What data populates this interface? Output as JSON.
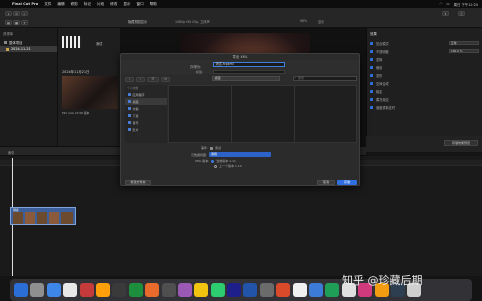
{
  "menubar": {
    "app": "Final Cut Pro",
    "items": [
      "文件",
      "编辑",
      "修剪",
      "标记",
      "片段",
      "修改",
      "显示",
      "窗口",
      "帮助"
    ],
    "status_text": "周日 下午12:20"
  },
  "toolbar": {
    "center_label": "隐藏视图显示",
    "resolution": "1080p HD 25p, 立体声",
    "zoom": "96%",
    "view": "显示"
  },
  "sidebar": {
    "title": "资源库",
    "items": [
      "整体项目",
      "2024-11-21"
    ]
  },
  "browser": {
    "clip_label": "测试",
    "date_header": "2024年11月21日",
    "clip_name": "film look 23.98 版本"
  },
  "inspector": {
    "title": "效果",
    "rows": [
      {
        "label": "复合模式",
        "value": "正常"
      },
      {
        "label": "不透明度",
        "value": "100.0 %"
      },
      {
        "label": "变换",
        "value": ""
      },
      {
        "label": "裁剪",
        "value": ""
      },
      {
        "label": "变形",
        "value": ""
      },
      {
        "label": "空间合成",
        "value": ""
      },
      {
        "label": "稳定",
        "value": ""
      },
      {
        "label": "果冻效应",
        "value": ""
      },
      {
        "label": "速度重新定时",
        "value": ""
      }
    ],
    "save_preset": "存储效果预置"
  },
  "timeline": {
    "index_label": "索引",
    "clip_label": "测试"
  },
  "dialog": {
    "title": "导出 XML",
    "save_as_label": "存储为:",
    "save_as_value": "测试.fcpxml",
    "tags_label": "标签:",
    "location": "桌面",
    "search_placeholder": "搜索",
    "sidebar_header": "个人收藏",
    "sidebar_items": [
      "应用程序",
      "桌面",
      "文稿",
      "下载",
      "音乐",
      "影片"
    ],
    "selected_item": "桌面",
    "project_label": "事件:",
    "project_value": "测试",
    "format_label": "元数据视图:",
    "format_value": "通用",
    "xml_version_label": "XML 版本:",
    "xml_options": [
      "当前版本 1.11",
      "上一个版本 1.10"
    ],
    "new_folder": "新建文件夹",
    "cancel": "取消",
    "save": "存储"
  },
  "watermark": "知乎 @珍藏后期",
  "dock": {
    "colors": [
      "#2b6fd6",
      "#8f8f8f",
      "#3e86e8",
      "#e8e8e8",
      "#c53b3b",
      "#ff9f0a",
      "#3a3a3a",
      "#1d8f3c",
      "#e86b2b",
      "#4f4f4f",
      "#9b59b6",
      "#f1c40f",
      "#2ecc71",
      "#1f1f8c",
      "#2255aa",
      "#6b6b6b",
      "#d94a2b",
      "#f0f0f0",
      "#3d7bd8",
      "#1f9e57",
      "#e0e0e0",
      "#d13a7c",
      "#f39c12",
      "#2c3e50",
      "#cfcfcf"
    ]
  }
}
